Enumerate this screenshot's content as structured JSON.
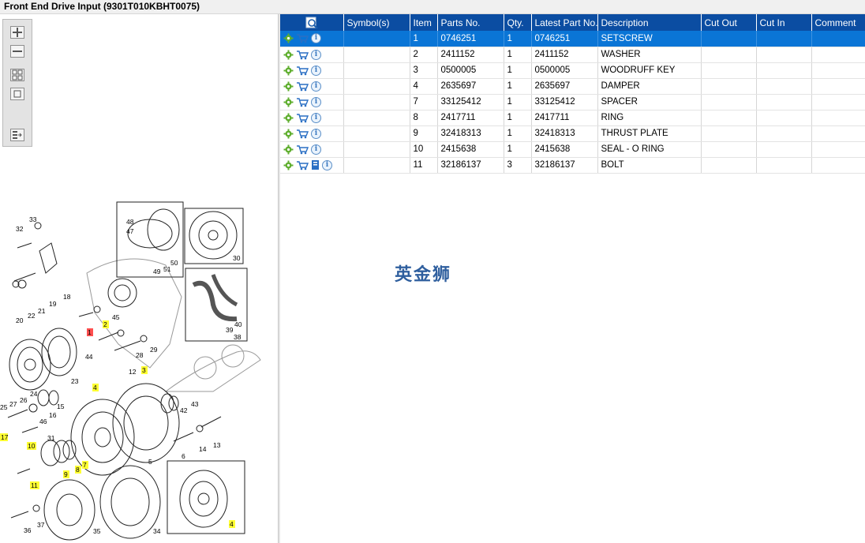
{
  "window": {
    "title": "Front End Drive Input (9301T010KBHT0075)"
  },
  "toolbar": {
    "buttons": [
      {
        "name": "zoom-in-icon"
      },
      {
        "name": "zoom-out-icon"
      },
      {
        "name": "fit-page-icon"
      },
      {
        "name": "actual-size-icon"
      },
      {
        "name": "toggle-list-icon"
      }
    ]
  },
  "table": {
    "columns": [
      "",
      "Symbol(s)",
      "Item",
      "Parts No.",
      "Qty.",
      "Latest Part No.",
      "Description",
      "Cut Out",
      "Cut In",
      "Comment"
    ],
    "rows": [
      {
        "item": "1",
        "part_no": "0746251",
        "qty": "1",
        "latest": "0746251",
        "desc": "SETSCREW",
        "selected": true,
        "extra_icon": false
      },
      {
        "item": "2",
        "part_no": "2411152",
        "qty": "1",
        "latest": "2411152",
        "desc": "WASHER",
        "selected": false,
        "extra_icon": false
      },
      {
        "item": "3",
        "part_no": "0500005",
        "qty": "1",
        "latest": "0500005",
        "desc": "WOODRUFF KEY",
        "selected": false,
        "extra_icon": false
      },
      {
        "item": "4",
        "part_no": "2635697",
        "qty": "1",
        "latest": "2635697",
        "desc": "DAMPER",
        "selected": false,
        "extra_icon": false
      },
      {
        "item": "7",
        "part_no": "33125412",
        "qty": "1",
        "latest": "33125412",
        "desc": "SPACER",
        "selected": false,
        "extra_icon": false
      },
      {
        "item": "8",
        "part_no": "2417711",
        "qty": "1",
        "latest": "2417711",
        "desc": "RING",
        "selected": false,
        "extra_icon": false
      },
      {
        "item": "9",
        "part_no": "32418313",
        "qty": "1",
        "latest": "32418313",
        "desc": "THRUST PLATE",
        "selected": false,
        "extra_icon": false
      },
      {
        "item": "10",
        "part_no": "2415638",
        "qty": "1",
        "latest": "2415638",
        "desc": "SEAL - O RING",
        "selected": false,
        "extra_icon": false
      },
      {
        "item": "11",
        "part_no": "32186137",
        "qty": "3",
        "latest": "32186137",
        "desc": "BOLT",
        "selected": false,
        "extra_icon": true
      }
    ]
  },
  "watermark": "英金狮",
  "diagram": {
    "callouts": [
      "33",
      "32",
      "18",
      "19",
      "20",
      "22",
      "21",
      "48",
      "47",
      "49",
      "51",
      "50",
      "30",
      "45",
      "1",
      "2",
      "44",
      "28",
      "29",
      "39",
      "40",
      "38",
      "23",
      "25",
      "27",
      "26",
      "24",
      "16",
      "15",
      "46",
      "31",
      "17",
      "10",
      "9",
      "8",
      "7",
      "11",
      "36",
      "37",
      "35",
      "34",
      "12",
      "3",
      "4",
      "43",
      "42",
      "14",
      "13",
      "6",
      "5",
      "4"
    ],
    "highlighted": [
      "2",
      "3",
      "4",
      "7",
      "8",
      "9",
      "10",
      "11",
      "17",
      "4"
    ],
    "selected_callout": "1"
  },
  "colors": {
    "header_bg": "#0b4da2",
    "selected_row": "#0a75d6",
    "callout_highlight": "#ffff33",
    "callout_selected": "#ff4f4f"
  }
}
